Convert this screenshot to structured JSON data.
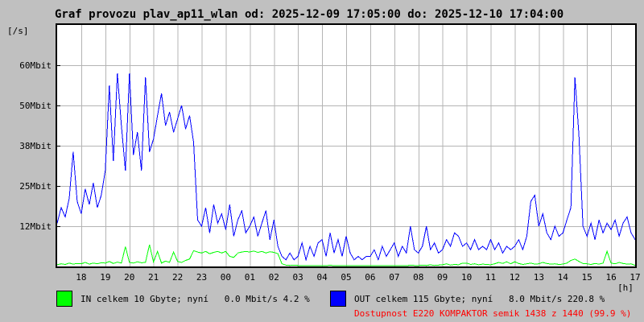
{
  "title": "Graf provozu plav_ap11_wlan od: 2025-12-09 17:05:00 do: 2025-12-10 17:04:00",
  "colors": {
    "background": "#c0c0c0",
    "plot_background": "#ffffff",
    "grid": "#b4b4b4",
    "border": "#000000",
    "in_series": "#00ff00",
    "out_series": "#0000ff",
    "availability_text": "#ff0000",
    "text": "#000000"
  },
  "chart_data": {
    "type": "line",
    "title": "Graf provozu plav_ap11_wlan od: 2025-12-09 17:05:00 do: 2025-12-10 17:04:00",
    "ylabel": "[/s]",
    "xlabel": "[h]",
    "grid": true,
    "x_range_hours": 24,
    "sample_interval_minutes": 10,
    "x_start_label": "17:05",
    "y_ticks": [
      {
        "label": "60Mbit",
        "value": 60
      },
      {
        "label": "50Mbit",
        "value": 50
      },
      {
        "label": "38Mbit",
        "value": 38
      },
      {
        "label": "25Mbit",
        "value": 25
      },
      {
        "label": "12Mbit",
        "value": 12
      }
    ],
    "x_ticks": [
      "18",
      "19",
      "20",
      "21",
      "22",
      "23",
      "00",
      "01",
      "02",
      "03",
      "04",
      "05",
      "06",
      "07",
      "08",
      "09",
      "10",
      "11",
      "12",
      "13",
      "14",
      "15",
      "16",
      "17"
    ],
    "series": [
      {
        "name": "IN",
        "color": "#00ff00",
        "unit": "Mbit/s",
        "values": [
          0.5,
          0.8,
          0.6,
          1.0,
          0.7,
          0.9,
          0.8,
          1.2,
          0.7,
          1.0,
          0.8,
          1.1,
          1.0,
          1.5,
          0.9,
          1.3,
          1.0,
          5.9,
          1.2,
          1.0,
          1.4,
          1.1,
          1.2,
          6.5,
          1.3,
          4.5,
          1.0,
          1.6,
          1.2,
          4.3,
          1.5,
          1.2,
          1.8,
          2.2,
          4.7,
          4.3,
          4.0,
          4.5,
          3.8,
          4.2,
          4.5,
          4.0,
          4.5,
          3.0,
          2.7,
          4.0,
          4.3,
          4.5,
          4.3,
          4.6,
          4.2,
          4.5,
          4.0,
          4.4,
          4.2,
          3.8,
          0.8,
          0.4,
          0.3,
          0.4,
          0.3,
          0.2,
          0.3,
          0.2,
          0.3,
          0.2,
          0.3,
          0.2,
          0.4,
          0.2,
          0.3,
          0.2,
          0.3,
          0.2,
          0.3,
          0.2,
          0.2,
          0.3,
          0.2,
          0.3,
          0.2,
          0.3,
          0.2,
          0.3,
          0.3,
          0.2,
          0.3,
          0.2,
          0.4,
          0.3,
          0.3,
          0.4,
          0.3,
          0.5,
          0.3,
          0.4,
          0.5,
          0.8,
          0.4,
          0.6,
          0.5,
          1.0,
          1.0,
          0.6,
          0.8,
          0.5,
          0.7,
          0.6,
          0.5,
          0.8,
          1.2,
          0.9,
          1.4,
          0.8,
          1.4,
          0.9,
          0.6,
          0.8,
          1.0,
          0.7,
          0.8,
          1.2,
          0.9,
          0.7,
          0.8,
          0.6,
          0.7,
          1.0,
          1.8,
          2.2,
          1.5,
          0.9,
          0.8,
          0.6,
          0.9,
          0.7,
          1.0,
          4.5,
          1.0,
          0.8,
          1.2,
          0.9,
          0.7,
          0.8,
          0.3
        ]
      },
      {
        "name": "OUT",
        "color": "#0000ff",
        "unit": "Mbit/s",
        "values": [
          13,
          18,
          15,
          21,
          36,
          20,
          16,
          24,
          19,
          26,
          18,
          22,
          30,
          55,
          33,
          58,
          44,
          30,
          58,
          35,
          42,
          30,
          57,
          36,
          40,
          47,
          53,
          44,
          48,
          42,
          46,
          50,
          43,
          47,
          39,
          14,
          12,
          18,
          10,
          19,
          13,
          16,
          11,
          19,
          9,
          14,
          17,
          10,
          12,
          15,
          9,
          13,
          17,
          8,
          14,
          6,
          3,
          2,
          4,
          2,
          3,
          7,
          2,
          6,
          3,
          7,
          8,
          3,
          10,
          4,
          8,
          3,
          9,
          4,
          2,
          3,
          2,
          3,
          3,
          5,
          2,
          6,
          3,
          5,
          7,
          3,
          6,
          4,
          12,
          5,
          4,
          6,
          12,
          5,
          7,
          4,
          5,
          8,
          6,
          10,
          9,
          6,
          7,
          5,
          8,
          5,
          6,
          5,
          8,
          5,
          7,
          4,
          6,
          5,
          6,
          8,
          5,
          9,
          20,
          22,
          12,
          16,
          10,
          8,
          12,
          9,
          10,
          14,
          18,
          57,
          41,
          12,
          9,
          13,
          8,
          14,
          10,
          13,
          11,
          14,
          9,
          13,
          15,
          10,
          8
        ]
      }
    ]
  },
  "legend": {
    "in": {
      "swatch_color": "#00ff00",
      "label": "IN celkem 10 Gbyte; nyní   0.0 Mbit/s 4.2 %"
    },
    "out": {
      "swatch_color": "#0000ff",
      "label": "OUT celkem 115 Gbyte; nyní   8.0 Mbit/s 220.8 %"
    },
    "availability": "Dostupnost E220 KOMPAKTOR semik 1438 z 1440 (99.9 %)"
  }
}
